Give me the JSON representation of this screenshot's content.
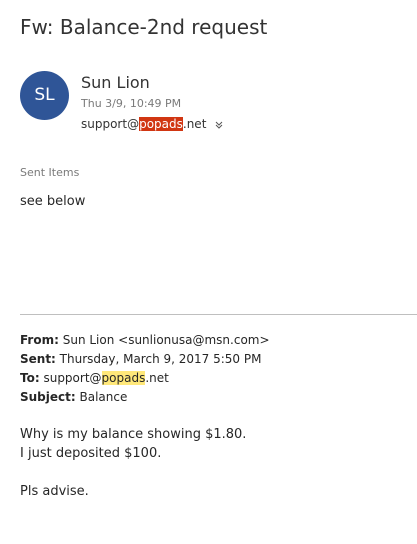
{
  "message": {
    "subject": "Fw: Balance-2nd request",
    "avatar_initials": "SL",
    "sender_name": "Sun Lion",
    "sent_date": "Thu 3/9, 10:49 PM",
    "to_prefix": "support@",
    "to_highlight": "popads",
    "to_suffix": ".net",
    "folder": "Sent Items",
    "body_intro": "see below"
  },
  "forwarded": {
    "from_label": "From:",
    "from_value": " Sun Lion <sunlionusa@msn.com>",
    "sent_label": "Sent:",
    "sent_value": " Thursday, March 9, 2017 5:50 PM",
    "to_label": "To:",
    "to_prefix": " support@",
    "to_highlight": "popads",
    "to_suffix": ".net",
    "subject_label": "Subject:",
    "subject_value": " Balance",
    "lines": [
      "Why is my balance showing $1.80.",
      "I just deposited $100.",
      "Pls advise."
    ]
  },
  "colors": {
    "avatar_bg": "#2f5597",
    "highlight_red": "#d13612",
    "highlight_yellow": "#ffe87a"
  },
  "icons": {
    "expand": "chevron-down-icon"
  }
}
